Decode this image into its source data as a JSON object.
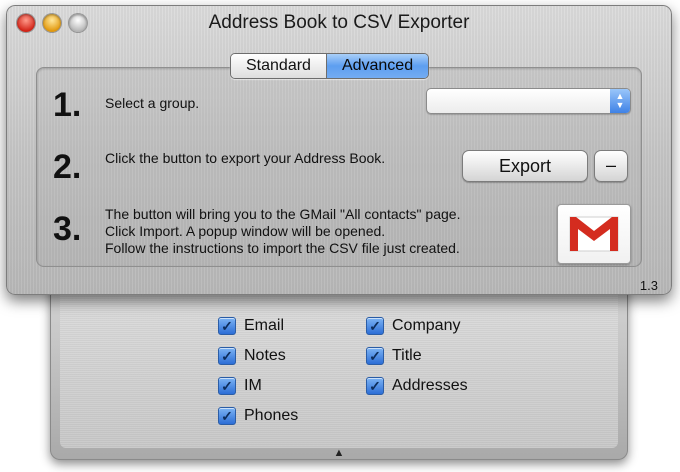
{
  "window": {
    "title": "Address Book to CSV Exporter",
    "version": "1.3"
  },
  "tabs": [
    {
      "label": "Standard",
      "selected": false
    },
    {
      "label": "Advanced",
      "selected": true
    }
  ],
  "steps": [
    {
      "number": "1.",
      "text": "Select a group."
    },
    {
      "number": "2.",
      "text": "Click the button to export your Address Book."
    },
    {
      "number": "3.",
      "lines": [
        "The button will bring you to the GMail \"All contacts\" page.",
        "Click Import. A popup window will be opened.",
        "Follow the instructions to import the CSV file just created."
      ]
    }
  ],
  "group_select": {
    "value": ""
  },
  "buttons": {
    "export_label": "Export",
    "minus_label": "–",
    "gmail_icon": "gmail-icon"
  },
  "fields": {
    "left": [
      {
        "label": "Email",
        "checked": true
      },
      {
        "label": "Notes",
        "checked": true
      },
      {
        "label": "IM",
        "checked": true
      },
      {
        "label": "Phones",
        "checked": true
      }
    ],
    "right": [
      {
        "label": "Company",
        "checked": true
      },
      {
        "label": "Title",
        "checked": true
      },
      {
        "label": "Addresses",
        "checked": true
      }
    ]
  },
  "colors": {
    "accent": "#5d9ef0",
    "gmail_red": "#d42c1f"
  }
}
